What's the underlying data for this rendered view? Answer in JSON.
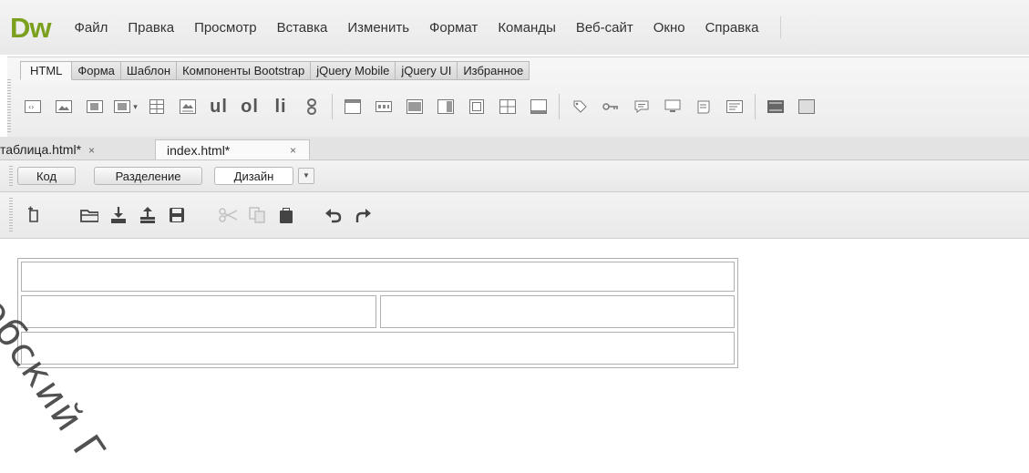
{
  "app": {
    "logo": "Dw"
  },
  "menu": [
    "Файл",
    "Правка",
    "Просмотр",
    "Вставка",
    "Изменить",
    "Формат",
    "Команды",
    "Веб-сайт",
    "Окно",
    "Справка"
  ],
  "insert_panel": {
    "tabs": [
      "HTML",
      "Форма",
      "Шаблон",
      "Компоненты Bootstrap",
      "jQuery Mobile",
      "jQuery UI",
      "Избранное"
    ],
    "active_tab": "HTML",
    "text_buttons": {
      "ul": "ul",
      "ol": "ol",
      "li": "li"
    }
  },
  "document_tabs": [
    {
      "label": "таблица.html*",
      "close": "×",
      "active": false
    },
    {
      "label": "index.html*",
      "close": "×",
      "active": true
    }
  ],
  "view_modes": {
    "code": "Код",
    "split": "Разделение",
    "design": "Дизайн",
    "active": "Дизайн",
    "dropdown": "▼"
  },
  "standard_toolbar": {
    "icons": [
      "new-document-icon",
      "open-folder-icon",
      "download-icon",
      "upload-icon",
      "save-icon",
      "cut-icon",
      "copy-icon",
      "paste-icon",
      "undo-icon",
      "redo-icon"
    ],
    "glyphs": {
      "new": "⎘",
      "open": "▭",
      "download": "⤓",
      "upload": "⤒",
      "save": "▆",
      "cut": "✂",
      "copy": "❐",
      "paste": "▮",
      "undo": "↶",
      "redo": "↷"
    }
  },
  "design_view": {
    "table_rows": [
      {
        "cells": [
          ""
        ]
      },
      {
        "cells": [
          "",
          ""
        ]
      },
      {
        "cells": [
          ""
        ]
      }
    ]
  },
  "watermark": "Бобский Г"
}
